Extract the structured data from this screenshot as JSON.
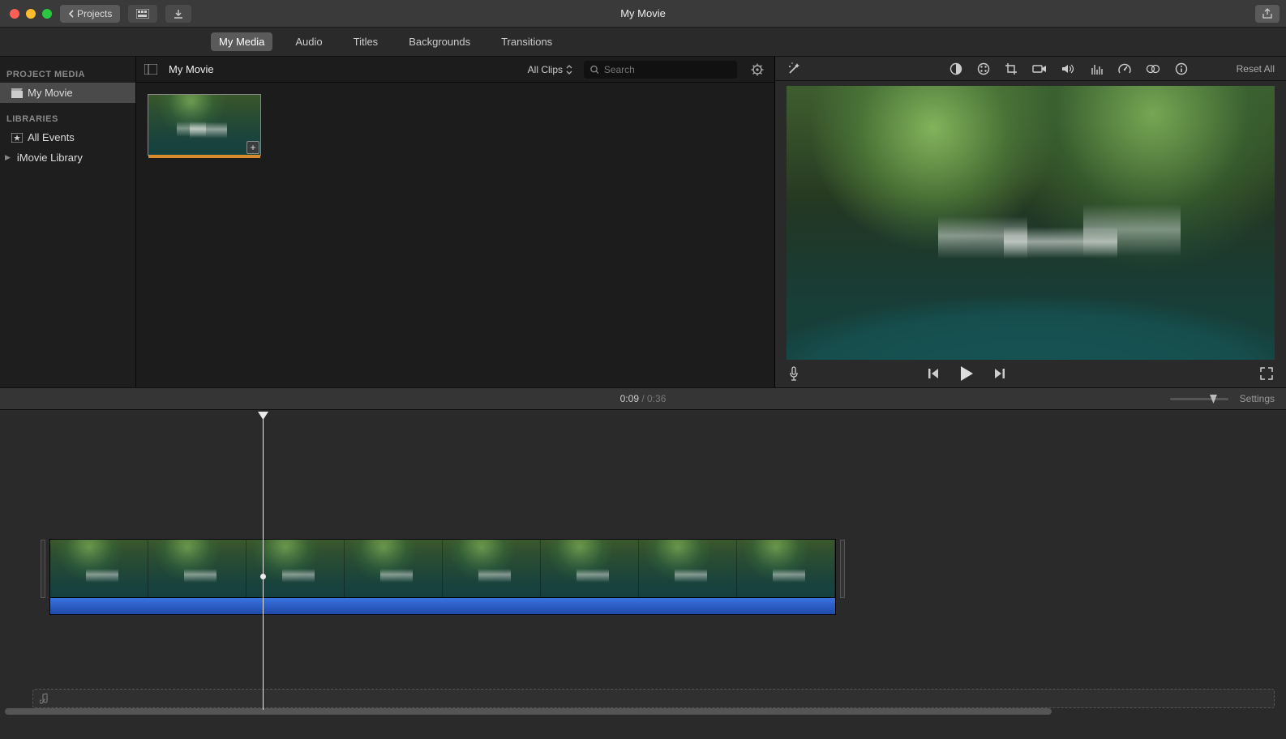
{
  "titlebar": {
    "back_label": "Projects",
    "title": "My Movie"
  },
  "tabs": {
    "items": [
      "My Media",
      "Audio",
      "Titles",
      "Backgrounds",
      "Transitions"
    ],
    "active": "My Media"
  },
  "sidebar": {
    "project_heading": "PROJECT MEDIA",
    "project_item": "My Movie",
    "libraries_heading": "LIBRARIES",
    "all_events": "All Events",
    "library": "iMovie Library"
  },
  "browser": {
    "title": "My Movie",
    "filter": "All Clips",
    "search_placeholder": "Search"
  },
  "viewer": {
    "reset_label": "Reset All"
  },
  "timeline": {
    "current": "0:09",
    "total": "0:36",
    "sep": " / ",
    "settings_label": "Settings"
  }
}
